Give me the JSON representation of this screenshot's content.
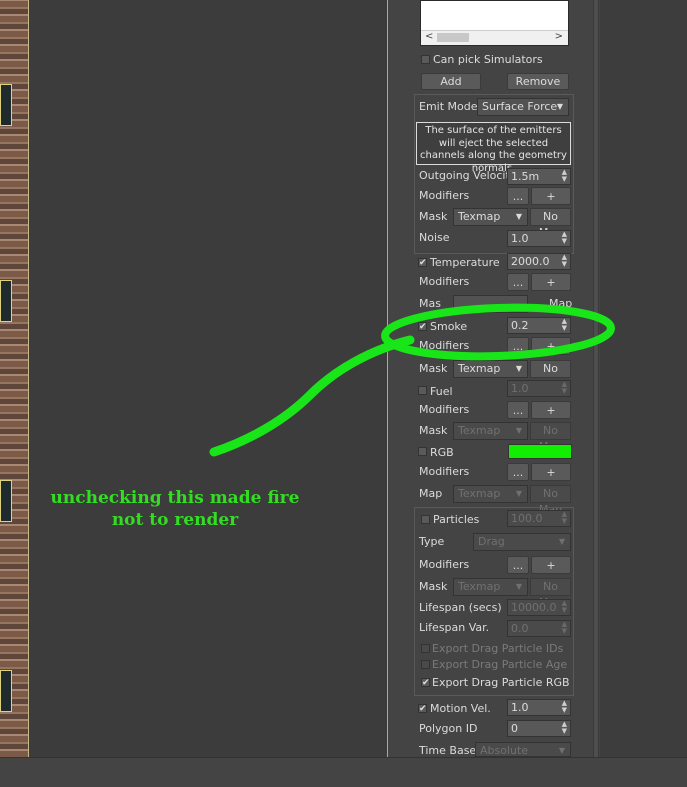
{
  "simulators": {
    "can_pick_label": "Can pick Simulators",
    "can_pick_checked": false,
    "add_label": "Add",
    "remove_label": "Remove",
    "scroll_left": "<",
    "scroll_right": ">"
  },
  "emit": {
    "mode_label": "Emit Mode",
    "mode_value": "Surface Force",
    "description": "The surface of the emitters will eject the selected channels along the geometry normals.",
    "velocity_label": "Outgoing Velocity",
    "velocity_value": "1.5m",
    "modifiers_label": "Modifiers",
    "dots": "...",
    "plus": "+",
    "mask_label": "Mask",
    "mask_value": "Texmap",
    "nomap": "No Map",
    "noise_label": "Noise",
    "noise_value": "1.0"
  },
  "temperature": {
    "label": "Temperature",
    "checked": true,
    "value": "2000.0",
    "modifiers_label": "Modifiers",
    "mask_partial": "Mas",
    "nomap_partial": "Map"
  },
  "smoke": {
    "label": "Smoke",
    "checked": true,
    "value": "0.2",
    "modifiers_label": "Modifiers",
    "mask_label": "Mask",
    "mask_value": "Texmap",
    "nomap": "No Map"
  },
  "fuel": {
    "label": "Fuel",
    "checked": false,
    "value": "1.0",
    "modifiers_label": "Modifiers",
    "mask_label": "Mask",
    "mask_value": "Texmap",
    "nomap": "No Map"
  },
  "rgb": {
    "label": "RGB",
    "checked": false,
    "swatch_color": "#11ee00",
    "modifiers_label": "Modifiers",
    "map_label": "Map",
    "map_value": "Texmap",
    "nomap": "No Map"
  },
  "particles": {
    "label": "Particles",
    "checked": false,
    "value": "100.0",
    "type_label": "Type",
    "type_value": "Drag",
    "modifiers_label": "Modifiers",
    "mask_label": "Mask",
    "mask_value": "Texmap",
    "nomap": "No Map",
    "lifespan_label": "Lifespan (secs)",
    "lifespan_value": "10000.0",
    "lifespan_var_label": "Lifespan Var.",
    "lifespan_var_value": "0.0",
    "export_ids_label": "Export Drag Particle IDs",
    "export_ids_checked": false,
    "export_age_label": "Export Drag Particle Age",
    "export_age_checked": false,
    "export_rgb_label": "Export Drag Particle RGB",
    "export_rgb_checked": true
  },
  "motion": {
    "label": "Motion Vel.",
    "checked": true,
    "value": "1.0",
    "polygon_label": "Polygon ID",
    "polygon_value": "0",
    "timebase_label": "Time Base",
    "timebase_value": "Absolute"
  },
  "annotation": {
    "text": "unchecking this made fire not to render",
    "color": "#33dd22"
  }
}
